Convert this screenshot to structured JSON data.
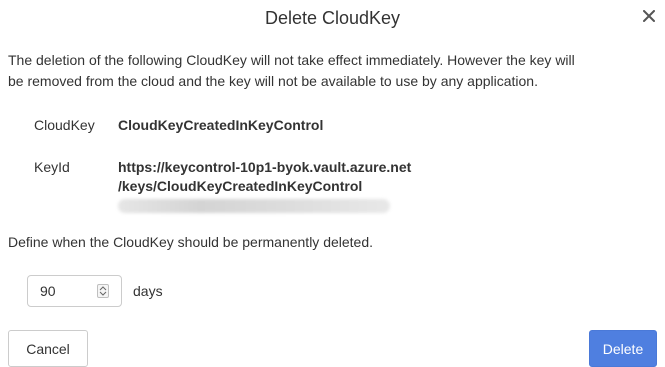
{
  "dialog": {
    "title": "Delete CloudKey",
    "close_icon": "close-icon"
  },
  "description": {
    "line1": "The deletion of the following CloudKey will not take effect immediately. However the key will",
    "line2": "be removed from the cloud and the key will not be available to use by any application."
  },
  "cloudkey": {
    "label": "CloudKey",
    "value": "CloudKeyCreatedInKeyControl"
  },
  "keyid": {
    "label": "KeyId",
    "value_line1": "https://keycontrol-10p1-byok.vault.azure.net",
    "value_line2": "/keys/CloudKeyCreatedInKeyControl"
  },
  "deletion": {
    "prompt": "Define when the CloudKey should be permanently deleted.",
    "days_value": "90",
    "days_unit": "days",
    "spin_icon": "spinner-arrows-icon"
  },
  "buttons": {
    "cancel": "Cancel",
    "delete": "Delete"
  }
}
